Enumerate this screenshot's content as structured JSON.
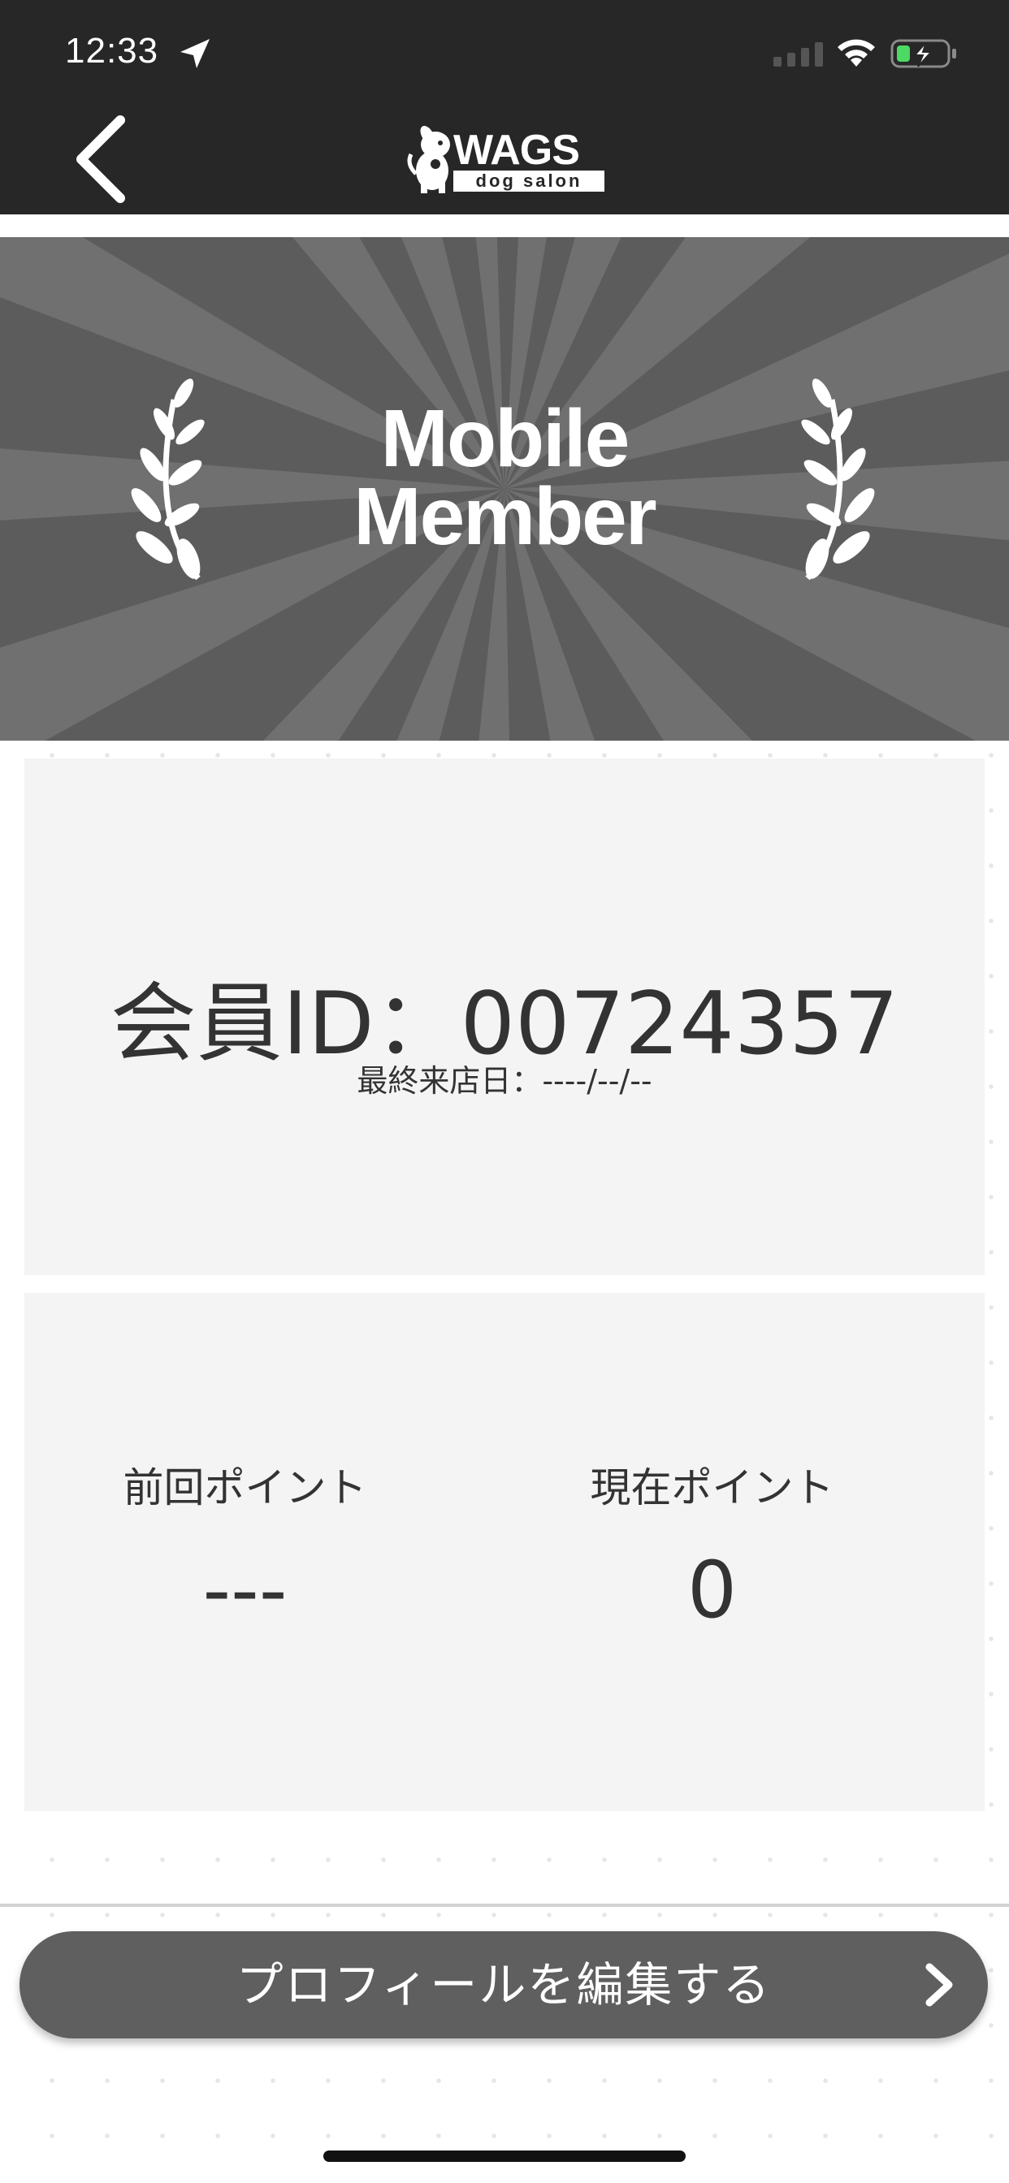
{
  "status_bar": {
    "time": "12:33",
    "icons": [
      "location-arrow-icon",
      "cellular-signal-icon",
      "wifi-icon",
      "battery-charging-icon"
    ]
  },
  "header": {
    "back_icon": "chevron-left-icon",
    "logo": {
      "brand": "WAGS",
      "tagline": "dog salon"
    }
  },
  "hero": {
    "title_line1": "Mobile",
    "title_line2": "Member",
    "decoration": "laurel-icon"
  },
  "member_card": {
    "id_label": "会員ID：",
    "id_value": "00724357",
    "last_visit": "最終来店日：----/--/--"
  },
  "points_card": {
    "previous_label": "前回ポイント",
    "previous_value": "---",
    "current_label": "現在ポイント",
    "current_value": "0"
  },
  "edit_profile": {
    "label": "プロフィールを編集する",
    "icon": "chevron-right-icon"
  },
  "colors": {
    "header_bg": "#272727",
    "hero_bg": "#5c5c5c",
    "card_bg": "#f4f4f4",
    "button_bg": "#5f5f5f",
    "battery_green": "#4cd964"
  }
}
